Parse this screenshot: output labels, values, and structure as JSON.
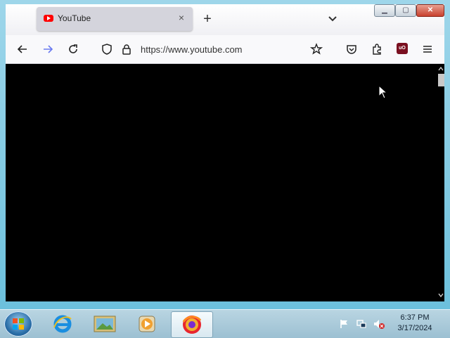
{
  "browser": {
    "tab_title": "YouTube",
    "url": "https://www.youtube.com",
    "ublock_label": "uO"
  },
  "taskbar": {
    "apps": [
      "internet-explorer",
      "photo-gallery",
      "media-player",
      "firefox"
    ],
    "active_app": "firefox"
  },
  "clock": {
    "time": "6:37 PM",
    "date": "3/17/2024"
  },
  "colors": {
    "page_background": "#000000",
    "youtube_red": "#ff0000",
    "navbar": "#f9f9fb"
  }
}
